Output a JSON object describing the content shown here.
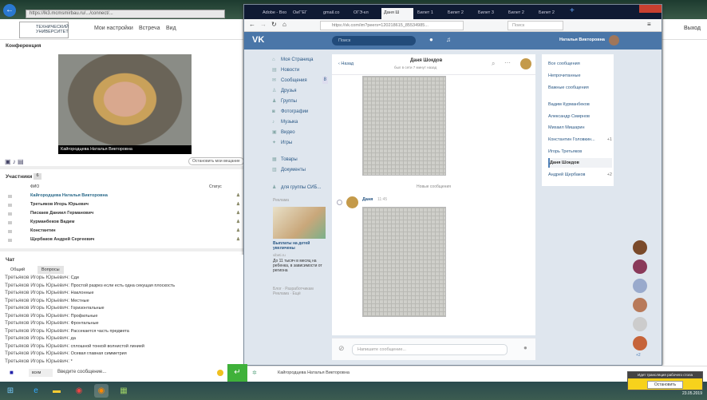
{
  "ie": {
    "url": "https://lk3.mcmsmirbau.ru/.../connect/...",
    "back": "←"
  },
  "app": {
    "logo": "ТЕХНИЧЕСКИЙ УНИВЕРСИТЕТ",
    "menu": [
      "Мои настройки",
      "Встреча",
      "Вид"
    ],
    "logout": "Выход"
  },
  "conference": {
    "title": "Конференция",
    "presenter": "Кайгородцева Наталья Викторовна",
    "stop_share": "Остановить мои вещание"
  },
  "participants": {
    "title": "Участники",
    "count": "6",
    "col_name": "ФИО",
    "col_status": "Статус",
    "rows": [
      "Кайгородцева Наталья Викторовна",
      "Третьяков Игорь Юрьевич",
      "Пискаев Даниил Германович",
      "Курманбеков Вадим",
      "Константин",
      "Щербаков Андрей Сергеевич"
    ]
  },
  "chat": {
    "title": "Чат",
    "tabs": [
      "Общий",
      "Вопросы"
    ],
    "sender": "Третьяков Игорь Юрьевич:",
    "messages": [
      "Сди",
      "Простой разрез если есть одна секущая плоскость",
      "Наклонные",
      "Местные",
      "Горизонтальные",
      "Профильные",
      "Фронтальные",
      "Рассекается часть предмета",
      "да",
      "сплошной тонкой волнистой линией",
      "Осевая главная симметрия",
      "*"
    ],
    "recipient": "всем",
    "placeholder": "Введите сообщение..."
  },
  "browser": {
    "tabs": [
      "Adobe - Вхо",
      "ОиГ'ЕГ",
      "gmail.co",
      "ОГЭ-кл",
      "Даня Ш",
      "Билет 1",
      "Билет 2",
      "Билет 3",
      "Билет 2",
      "Билет 2"
    ],
    "url": "https://vk.com/im?peers=120218615_85534985...",
    "search_placeholder": "Поиск"
  },
  "vk": {
    "logo": "VK",
    "search": "Поиск",
    "user": "Наталья Викторовна",
    "nav": [
      "Моя Страница",
      "Новости",
      "Сообщения",
      "Друзья",
      "Группы",
      "Фотографии",
      "Музыка",
      "Видео",
      "Игры",
      "Товары",
      "Документы",
      "для группы СИБ..."
    ],
    "messages_badge": "8",
    "ads_title": "Реклама",
    "ad_headline": "Выплаты на детей увеличены",
    "ad_domain": "vibeti.ru",
    "ad_text": "До 11 тысяч в месяц на ребенка, в зависимости от региона",
    "footer": [
      "Блог",
      "Разработчикам",
      "Реклама",
      "Ещё"
    ],
    "conv": {
      "back": "Назад",
      "name": "Даня Шокдов",
      "status": "был в сети 7 минут назад",
      "new_messages": "Новые сообщения",
      "msg_author": "Даня",
      "msg_time": "11:45",
      "input_placeholder": "Напишите сообщение..."
    },
    "right_nav": [
      {
        "label": "Все сообщения"
      },
      {
        "label": "Непрочитанные"
      },
      {
        "label": "Важные сообщения"
      },
      {
        "label": "Вадим Курманбеков"
      },
      {
        "label": "Александр Смирнов"
      },
      {
        "label": "Михаил Мишарин"
      },
      {
        "label": "Константин Головкин...",
        "count": "+1"
      },
      {
        "label": "Игорь Третьяков"
      },
      {
        "label": "Даня Шокдов",
        "selected": true
      },
      {
        "label": "Андрей Щербаков",
        "count": "+2"
      }
    ],
    "side_count": "+2"
  },
  "bottom": {
    "presenter": "Кайгородцева Наталья Викторовна"
  },
  "notice": {
    "title": "Идет трансляция рабочего стола",
    "button": "Остановить"
  },
  "taskbar": {
    "date": "23.05.2019"
  }
}
